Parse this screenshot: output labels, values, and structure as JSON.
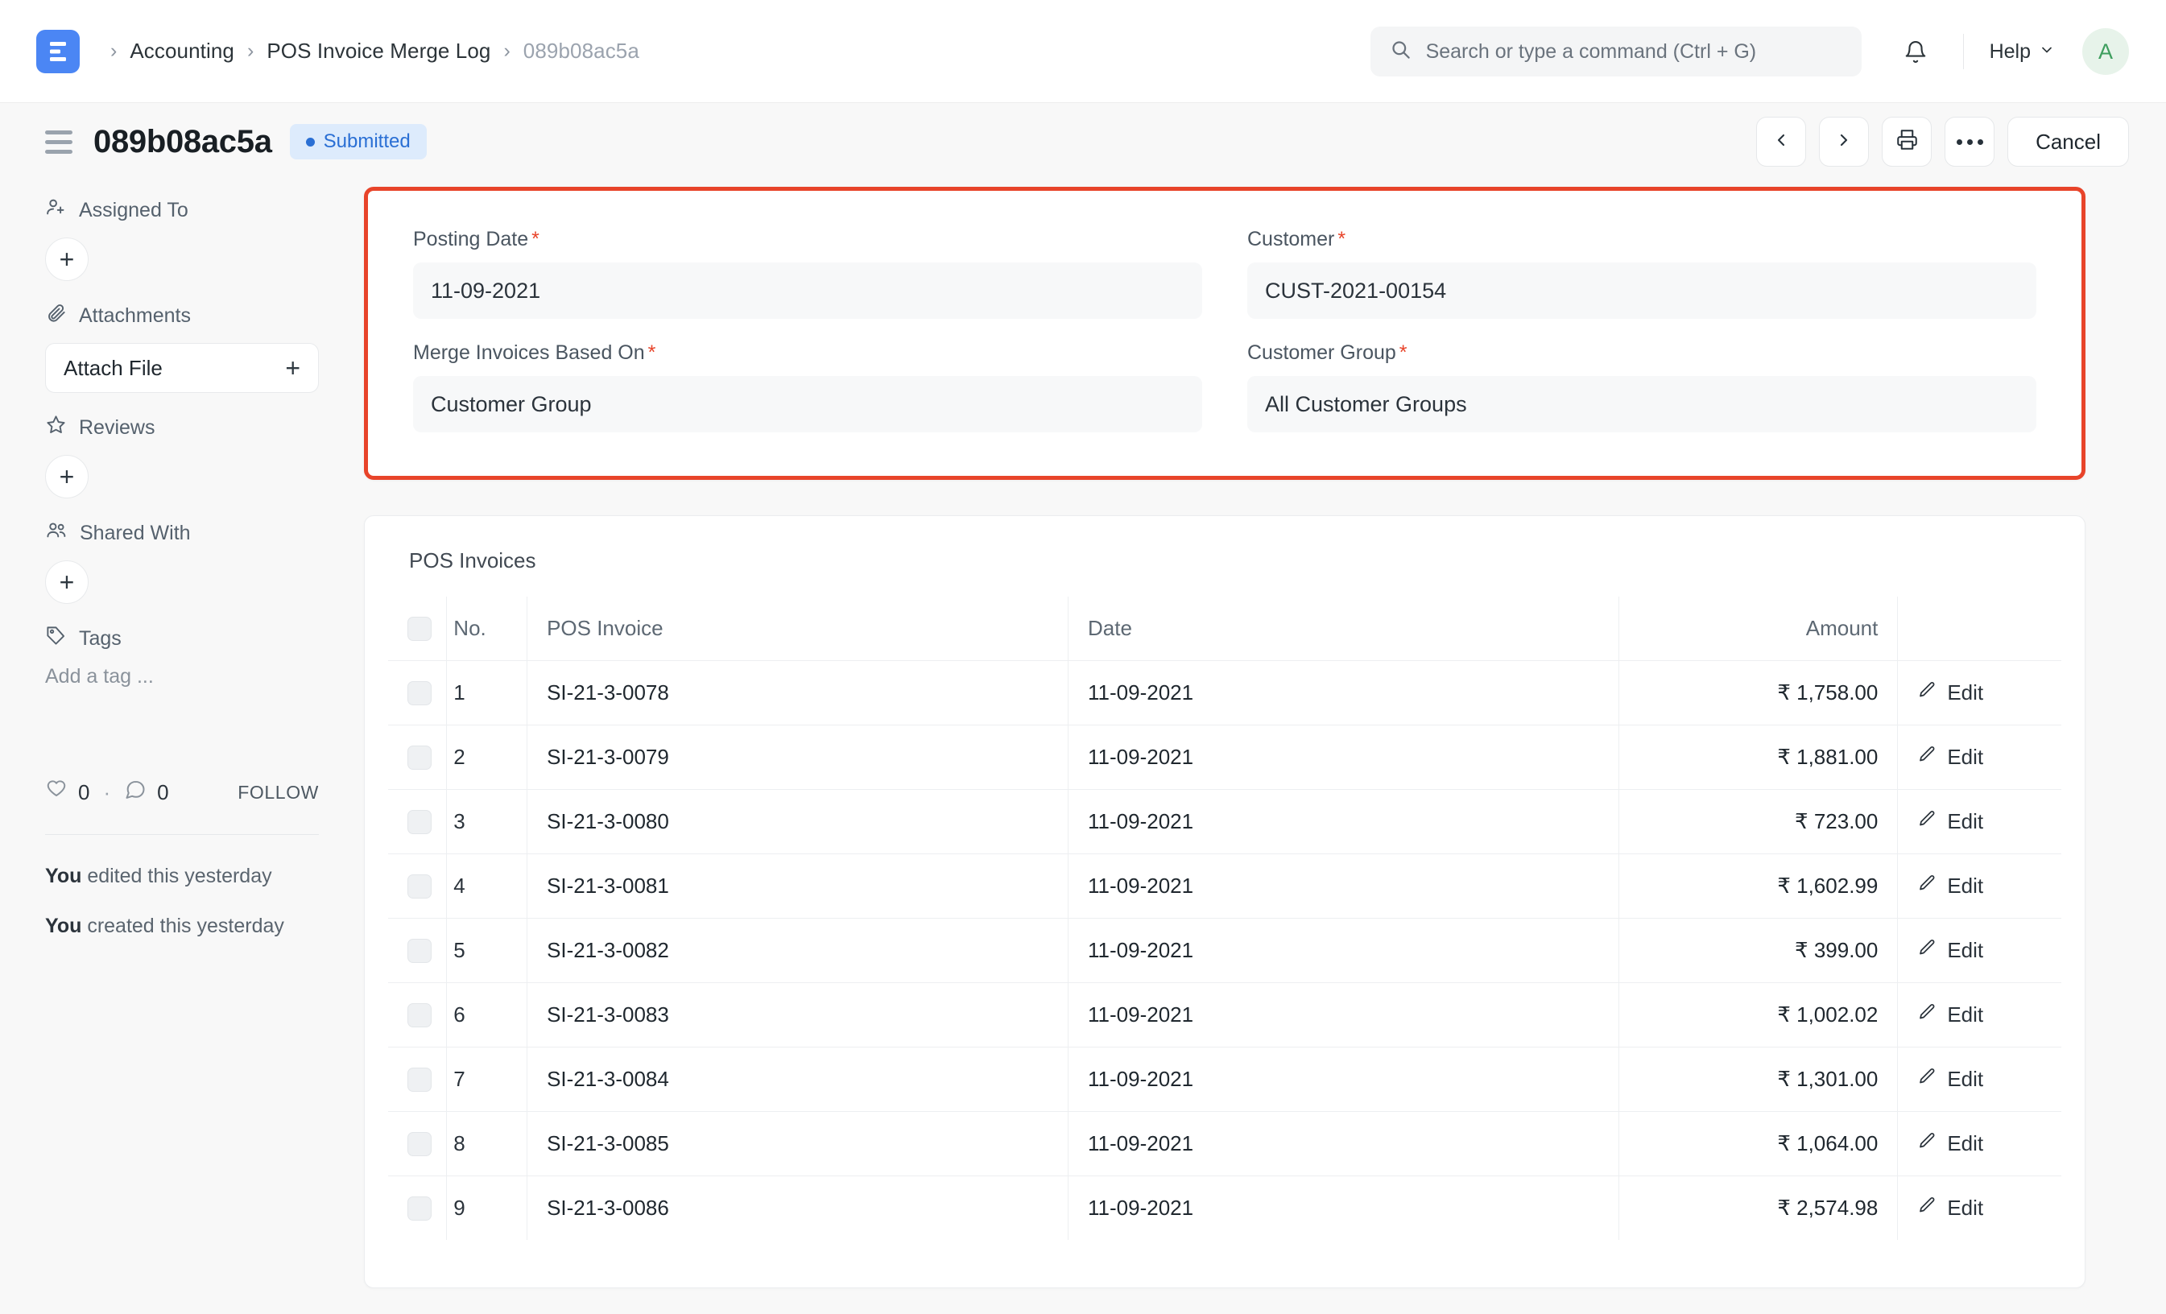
{
  "navbar": {
    "logo_icon": "erpnext-logo-icon",
    "breadcrumb": [
      {
        "label": "Accounting",
        "current": false
      },
      {
        "label": "POS Invoice Merge Log",
        "current": false
      },
      {
        "label": "089b08ac5a",
        "current": true
      }
    ],
    "separator": "›",
    "search_placeholder": "Search or type a command (Ctrl + G)",
    "search_icon": "search-icon",
    "notification_icon": "bell-icon",
    "help_label": "Help",
    "help_caret_icon": "chevron-down-icon",
    "avatar_initial": "A",
    "avatar_bg": "#E7F3EA",
    "avatar_color": "#3E9E5E"
  },
  "titlebar": {
    "menu_icon": "hamburger-icon",
    "title": "089b08ac5a",
    "status": "Submitted",
    "status_bg": "#DDEBFC",
    "status_color": "#2A6FD4",
    "actions": {
      "prev_icon": "chevron-left-icon",
      "next_icon": "chevron-right-icon",
      "print_icon": "printer-icon",
      "more_icon": "ellipsis-icon",
      "cancel_label": "Cancel"
    }
  },
  "sidebar": {
    "assigned_to": {
      "icon": "user-plus-icon",
      "label": "Assigned To",
      "add_label": "+"
    },
    "attachments": {
      "icon": "paperclip-icon",
      "label": "Attachments",
      "button_label": "Attach File",
      "button_plus": "+"
    },
    "reviews": {
      "icon": "star-icon",
      "label": "Reviews",
      "add_label": "+"
    },
    "shared_with": {
      "icon": "users-icon",
      "label": "Shared With",
      "add_label": "+"
    },
    "tags": {
      "icon": "tag-icon",
      "label": "Tags",
      "placeholder": "Add a tag ..."
    },
    "meta": {
      "like_icon": "heart-icon",
      "like_count": "0",
      "separator": "·",
      "comment_icon": "comment-icon",
      "comment_count": "0",
      "follow_label": "FOLLOW"
    },
    "activity": [
      {
        "who": "You",
        "text": " edited this yesterday"
      },
      {
        "who": "You",
        "text": " created this yesterday"
      }
    ]
  },
  "form": {
    "highlight_color": "#E8442A",
    "required_marker": "*",
    "fields": [
      {
        "label": "Posting Date",
        "required": true,
        "value": "11-09-2021"
      },
      {
        "label": "Customer",
        "required": true,
        "value": "CUST-2021-00154"
      },
      {
        "label": "Merge Invoices Based On",
        "required": true,
        "value": "Customer Group"
      },
      {
        "label": "Customer Group",
        "required": true,
        "value": "All Customer Groups"
      }
    ]
  },
  "table": {
    "title": "POS Invoices",
    "columns": [
      "No.",
      "POS Invoice",
      "Date",
      "Amount",
      ""
    ],
    "edit_label": "Edit",
    "edit_icon": "pencil-icon",
    "rows": [
      {
        "no": "1",
        "invoice": "SI-21-3-0078",
        "date": "11-09-2021",
        "amount": "₹ 1,758.00"
      },
      {
        "no": "2",
        "invoice": "SI-21-3-0079",
        "date": "11-09-2021",
        "amount": "₹ 1,881.00"
      },
      {
        "no": "3",
        "invoice": "SI-21-3-0080",
        "date": "11-09-2021",
        "amount": "₹ 723.00"
      },
      {
        "no": "4",
        "invoice": "SI-21-3-0081",
        "date": "11-09-2021",
        "amount": "₹ 1,602.99"
      },
      {
        "no": "5",
        "invoice": "SI-21-3-0082",
        "date": "11-09-2021",
        "amount": "₹ 399.00"
      },
      {
        "no": "6",
        "invoice": "SI-21-3-0083",
        "date": "11-09-2021",
        "amount": "₹ 1,002.02"
      },
      {
        "no": "7",
        "invoice": "SI-21-3-0084",
        "date": "11-09-2021",
        "amount": "₹ 1,301.00"
      },
      {
        "no": "8",
        "invoice": "SI-21-3-0085",
        "date": "11-09-2021",
        "amount": "₹ 1,064.00"
      },
      {
        "no": "9",
        "invoice": "SI-21-3-0086",
        "date": "11-09-2021",
        "amount": "₹ 2,574.98"
      }
    ]
  }
}
